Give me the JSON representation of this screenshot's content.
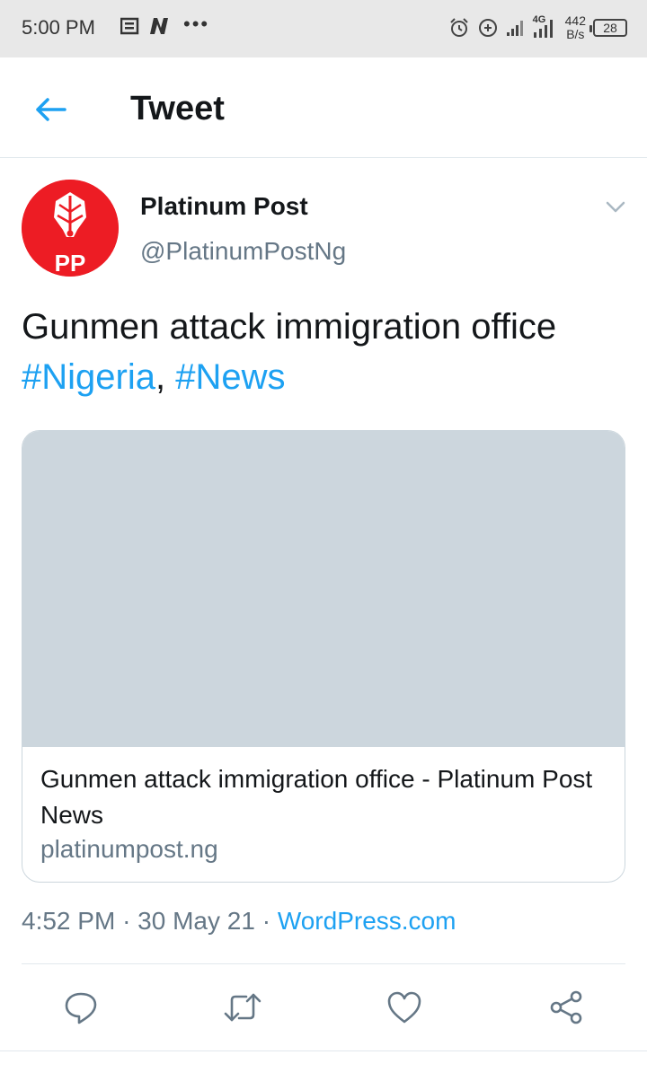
{
  "status_bar": {
    "time": "5:00 PM",
    "speed_value": "442",
    "speed_unit": "B/s",
    "battery": "28",
    "network": "4G"
  },
  "header": {
    "title": "Tweet"
  },
  "tweet": {
    "author_name": "Platinum Post",
    "author_handle": "@PlatinumPostNg",
    "avatar_text": "PP",
    "text_plain": "Gunmen attack immigration office",
    "hashtag_1": "#Nigeria",
    "separator": ",",
    "hashtag_2": "#News",
    "card": {
      "title": "Gunmen attack immigration office - Platinum Post News",
      "domain": "platinumpost.ng"
    },
    "time": "4:52 PM",
    "date": "30 May 21",
    "source": "WordPress.com"
  },
  "colors": {
    "accent": "#1da1f2",
    "avatar_bg": "#ed1c24",
    "secondary_text": "#657786"
  },
  "icons": {
    "back": "arrow-left-icon",
    "caret": "chevron-down-icon",
    "reply": "reply-icon",
    "retweet": "retweet-icon",
    "like": "heart-icon",
    "share": "share-icon"
  }
}
